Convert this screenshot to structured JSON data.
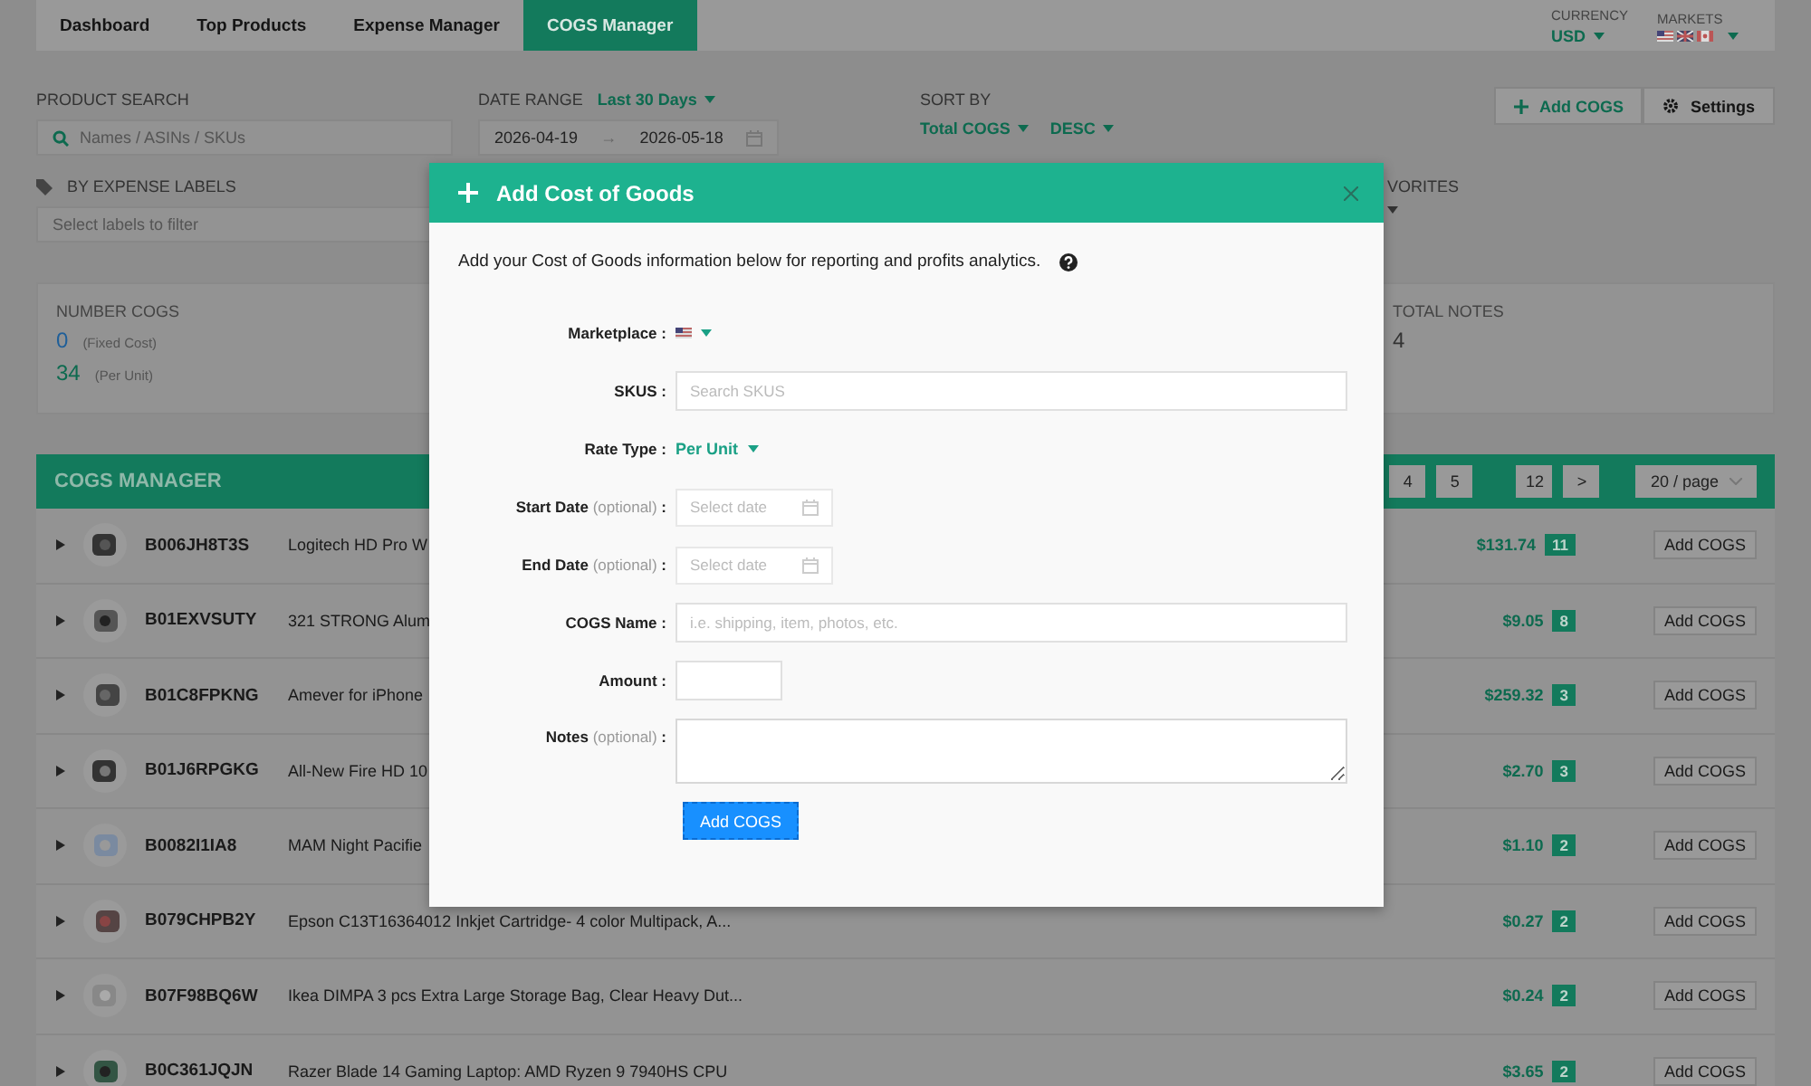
{
  "nav": {
    "tabs": [
      {
        "label": "Dashboard",
        "selected": false
      },
      {
        "label": "Top Products",
        "selected": false
      },
      {
        "label": "Expense Manager",
        "selected": false
      },
      {
        "label": "COGS Manager",
        "selected": true
      }
    ],
    "currency": {
      "label": "CURRENCY",
      "value": "USD"
    },
    "markets": {
      "label": "MARKETS"
    }
  },
  "filters": {
    "product_search": {
      "label": "PRODUCT SEARCH",
      "placeholder": "Names / ASINs / SKUs"
    },
    "date_range": {
      "label": "DATE RANGE",
      "preset": "Last 30 Days",
      "start": "2026-04-19",
      "separator": "→",
      "end": "2026-05-18"
    },
    "sort_by": {
      "label": "SORT BY",
      "field": "Total COGS",
      "order": "DESC"
    },
    "actions": [
      "Add COGS",
      "Settings"
    ],
    "expense_labels": {
      "label": "BY EXPENSE LABELS",
      "placeholder": "Select labels to filter"
    },
    "favorites": {
      "label": "VORITES"
    }
  },
  "stats": {
    "number_cogs": {
      "label": "NUMBER COGS",
      "fixed_value": "0",
      "fixed_label": "(Fixed Cost)",
      "unit_value": "34",
      "unit_label": "(Per Unit)"
    },
    "total_notes": {
      "label": "TOTAL NOTES",
      "value": "4"
    }
  },
  "table": {
    "title": "COGS MANAGER",
    "pagination": {
      "pages": [
        "4",
        "5",
        "12"
      ],
      "next": ">",
      "page_size": "20 / page"
    },
    "rows": [
      {
        "asin": "B006JH8T3S",
        "title": "Logitech HD Pro W",
        "total": "$131.74",
        "count": "11",
        "action": "Add COGS"
      },
      {
        "asin": "B01EXVSUTY",
        "title": "321 STRONG Alum",
        "total": "$9.05",
        "count": "8",
        "action": "Add COGS"
      },
      {
        "asin": "B01C8FPKNG",
        "title": "Amever for iPhone",
        "total": "$259.32",
        "count": "3",
        "action": "Add COGS"
      },
      {
        "asin": "B01J6RPGKG",
        "title": "All-New Fire HD 10",
        "total": "$2.70",
        "count": "3",
        "action": "Add COGS"
      },
      {
        "asin": "B0082I1IA8",
        "title": "MAM Night Pacifie",
        "total": "$1.10",
        "count": "2",
        "action": "Add COGS"
      },
      {
        "asin": "B079CHPB2Y",
        "title": "Epson C13T16364012 Inkjet Cartridge- 4 color Multipack, A...",
        "total": "$0.27",
        "count": "2",
        "action": "Add COGS"
      },
      {
        "asin": "B07F98BQ6W",
        "title": "Ikea DIMPA 3 pcs Extra Large Storage Bag, Clear Heavy Dut...",
        "total": "$0.24",
        "count": "2",
        "action": "Add COGS"
      },
      {
        "asin": "B0C361JQJN",
        "title": "Razer Blade 14 Gaming Laptop: AMD Ryzen 9 7940HS CPU",
        "total": "$3.65",
        "count": "2",
        "action": "Add COGS"
      }
    ]
  },
  "modal": {
    "title": "Add Cost of Goods",
    "intro": "Add your Cost of Goods information below for reporting and profits analytics.",
    "fields": [
      {
        "kind": "marketplace",
        "label": "Marketplace"
      },
      {
        "kind": "input",
        "label": "SKUS",
        "placeholder": "Search SKUS"
      },
      {
        "kind": "select",
        "label": "Rate Type",
        "value": "Per Unit"
      },
      {
        "kind": "date",
        "label": "Start Date",
        "optional": "(optional)",
        "placeholder": "Select date"
      },
      {
        "kind": "date",
        "label": "End Date",
        "optional": "(optional)",
        "placeholder": "Select date"
      },
      {
        "kind": "input",
        "label": "COGS Name",
        "placeholder": "i.e. shipping, item, photos, etc."
      },
      {
        "kind": "short",
        "label": "Amount"
      },
      {
        "kind": "textarea",
        "label": "Notes",
        "optional": "(optional)"
      }
    ],
    "label_suffix": ":",
    "submit": "Add COGS"
  }
}
